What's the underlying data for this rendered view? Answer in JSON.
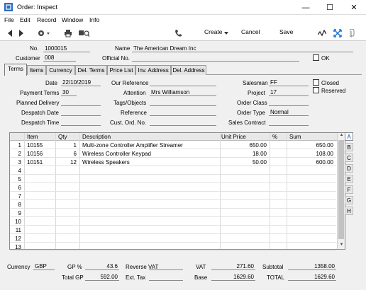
{
  "window": {
    "title": "Order: Inspect",
    "minimize": "—",
    "maximize": "☐",
    "close": "✕"
  },
  "menu": [
    "File",
    "Edit",
    "Record",
    "Window",
    "Info"
  ],
  "toolbar": {
    "create": "Create",
    "cancel": "Cancel",
    "save": "Save"
  },
  "header": {
    "no_label": "No.",
    "no_value": "1000015",
    "name_label": "Name",
    "name_value": "The American Dream Inc",
    "customer_label": "Customer",
    "customer_value": "008",
    "official_no_label": "Official No.",
    "official_no_value": "",
    "ok_label": "OK"
  },
  "tabs": [
    "Terms",
    "Items",
    "Currency",
    "Del. Terms",
    "Price List",
    "Inv. Address",
    "Del. Address"
  ],
  "terms": {
    "date_label": "Date",
    "date_value": "22/10/2019",
    "payment_terms_label": "Payment Terms",
    "payment_terms_value": "30",
    "planned_delivery_label": "Planned Delivery",
    "planned_delivery_value": "",
    "despatch_date_label": "Despatch Date",
    "despatch_date_value": "",
    "despatch_time_label": "Despatch Time",
    "despatch_time_value": "",
    "our_reference_label": "Our Reference",
    "our_reference_value": "",
    "attention_label": "Attention",
    "attention_value": "Mrs Williamson",
    "tags_label": "Tags/Objects",
    "tags_value": "",
    "reference_label": "Reference",
    "reference_value": "",
    "cust_ord_label": "Cust. Ord. No.",
    "cust_ord_value": "",
    "salesman_label": "Salesman",
    "salesman_value": "FF",
    "project_label": "Project",
    "project_value": "17",
    "order_class_label": "Order Class",
    "order_class_value": "",
    "order_type_label": "Order Type",
    "order_type_value": "Normal",
    "sales_contract_label": "Sales Contract",
    "sales_contract_value": "",
    "closed_label": "Closed",
    "reserved_label": "Reserved"
  },
  "grid": {
    "headers": [
      "Item",
      "Qty",
      "Description",
      "Unit Price",
      "%",
      "Sum"
    ],
    "rows": [
      {
        "n": "1",
        "item": "10155",
        "qty": "1",
        "desc": "Multi-zone Controller Amplifier Streamer",
        "price": "650.00",
        "pct": "",
        "sum": "650.00"
      },
      {
        "n": "2",
        "item": "10156",
        "qty": "6",
        "desc": "Wireless Controller Keypad",
        "price": "18.00",
        "pct": "",
        "sum": "108.00"
      },
      {
        "n": "3",
        "item": "10151",
        "qty": "12",
        "desc": "Wireless Speakers",
        "price": "50.00",
        "pct": "",
        "sum": "600.00"
      },
      {
        "n": "4",
        "item": "",
        "qty": "",
        "desc": "",
        "price": "",
        "pct": "",
        "sum": ""
      },
      {
        "n": "5",
        "item": "",
        "qty": "",
        "desc": "",
        "price": "",
        "pct": "",
        "sum": ""
      },
      {
        "n": "6",
        "item": "",
        "qty": "",
        "desc": "",
        "price": "",
        "pct": "",
        "sum": ""
      },
      {
        "n": "7",
        "item": "",
        "qty": "",
        "desc": "",
        "price": "",
        "pct": "",
        "sum": ""
      },
      {
        "n": "8",
        "item": "",
        "qty": "",
        "desc": "",
        "price": "",
        "pct": "",
        "sum": ""
      },
      {
        "n": "9",
        "item": "",
        "qty": "",
        "desc": "",
        "price": "",
        "pct": "",
        "sum": ""
      },
      {
        "n": "10",
        "item": "",
        "qty": "",
        "desc": "",
        "price": "",
        "pct": "",
        "sum": ""
      },
      {
        "n": "11",
        "item": "",
        "qty": "",
        "desc": "",
        "price": "",
        "pct": "",
        "sum": ""
      },
      {
        "n": "12",
        "item": "",
        "qty": "",
        "desc": "",
        "price": "",
        "pct": "",
        "sum": ""
      },
      {
        "n": "13",
        "item": "",
        "qty": "",
        "desc": "",
        "price": "",
        "pct": "",
        "sum": ""
      }
    ],
    "side_tabs": [
      "A",
      "B",
      "C",
      "D",
      "E",
      "F",
      "G",
      "H"
    ]
  },
  "footer": {
    "currency_label": "Currency",
    "currency_value": "GBP",
    "gp_pct_label": "GP %",
    "gp_pct_value": "43.6",
    "total_gp_label": "Total GP",
    "total_gp_value": "592.00",
    "reverse_vat_label": "Reverse VAT",
    "reverse_vat_value": "",
    "ext_tax_label": "Ext. Tax",
    "ext_tax_value": "",
    "vat_label": "VAT",
    "vat_value": "271.60",
    "base_label": "Base",
    "base_value": "1629.60",
    "subtotal_label": "Subtotal",
    "subtotal_value": "1358.00",
    "total_label": "TOTAL",
    "total_value": "1629.60"
  },
  "colors": {
    "accent": "#0057b7",
    "background": "#f0f0f0"
  }
}
